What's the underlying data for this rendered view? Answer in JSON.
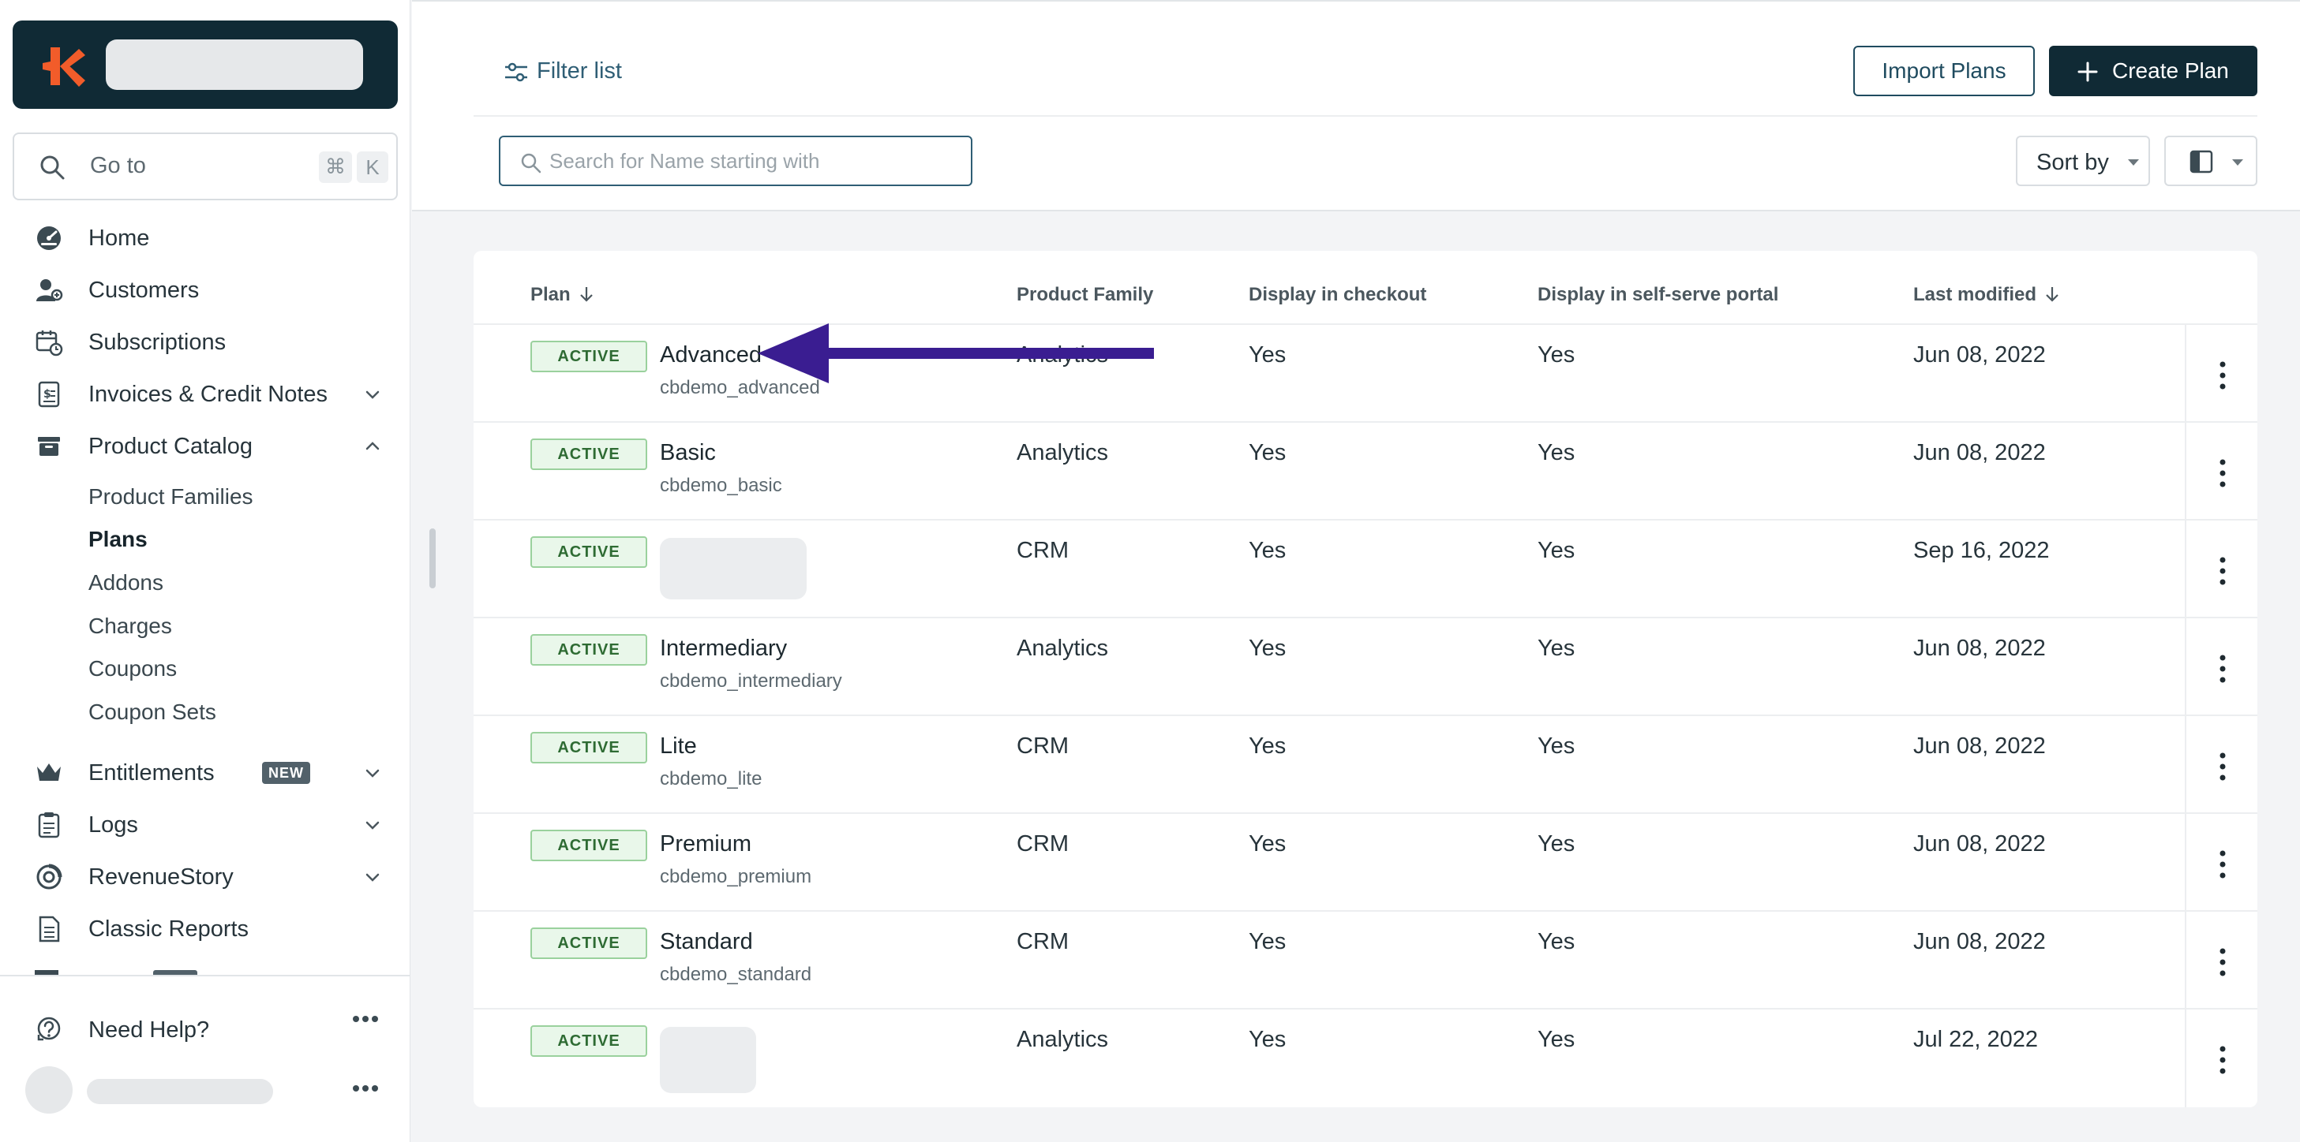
{
  "sidebar": {
    "goto": {
      "label": "Go to",
      "shortcut_cmd": "⌘",
      "shortcut_key": "K"
    },
    "nav": [
      {
        "label": "Home",
        "icon": "dashboard-gauge-icon"
      },
      {
        "label": "Customers",
        "icon": "customers-icon"
      },
      {
        "label": "Subscriptions",
        "icon": "subscriptions-calendar-icon"
      },
      {
        "label": "Invoices & Credit Notes",
        "icon": "invoice-icon",
        "expandable": true
      },
      {
        "label": "Product Catalog",
        "icon": "product-catalog-box-icon",
        "expanded": true
      },
      {
        "label": "Entitlements",
        "icon": "crown-icon",
        "badge": "NEW",
        "expandable": true
      },
      {
        "label": "Logs",
        "icon": "clipboard-icon",
        "expandable": true
      },
      {
        "label": "RevenueStory",
        "icon": "revenue-story-icon",
        "expandable": true
      },
      {
        "label": "Classic Reports",
        "icon": "report-icon"
      }
    ],
    "product_catalog_items": [
      "Product Families",
      "Plans",
      "Addons",
      "Charges",
      "Coupons",
      "Coupon Sets"
    ],
    "active_item": "Plans",
    "help_label": "Need Help?"
  },
  "toolbar": {
    "filter_label": "Filter list",
    "import_label": "Import Plans",
    "create_label": "Create Plan",
    "search_placeholder": "Search for Name starting with",
    "sort_label": "Sort by"
  },
  "table": {
    "headers": {
      "plan": "Plan",
      "family": "Product Family",
      "checkout": "Display in checkout",
      "portal": "Display in self-serve portal",
      "modified": "Last modified"
    },
    "rows": [
      {
        "status": "ACTIVE",
        "name": "Advanced",
        "id": "cbdemo_advanced",
        "family": "Analytics",
        "checkout": "Yes",
        "portal": "Yes",
        "modified": "Jun 08, 2022"
      },
      {
        "status": "ACTIVE",
        "name": "Basic",
        "id": "cbdemo_basic",
        "family": "Analytics",
        "checkout": "Yes",
        "portal": "Yes",
        "modified": "Jun 08, 2022"
      },
      {
        "status": "ACTIVE",
        "name": "",
        "id": "",
        "family": "CRM",
        "checkout": "Yes",
        "portal": "Yes",
        "modified": "Sep 16, 2022"
      },
      {
        "status": "ACTIVE",
        "name": "Intermediary",
        "id": "cbdemo_intermediary",
        "family": "Analytics",
        "checkout": "Yes",
        "portal": "Yes",
        "modified": "Jun 08, 2022"
      },
      {
        "status": "ACTIVE",
        "name": "Lite",
        "id": "cbdemo_lite",
        "family": "CRM",
        "checkout": "Yes",
        "portal": "Yes",
        "modified": "Jun 08, 2022"
      },
      {
        "status": "ACTIVE",
        "name": "Premium",
        "id": "cbdemo_premium",
        "family": "CRM",
        "checkout": "Yes",
        "portal": "Yes",
        "modified": "Jun 08, 2022"
      },
      {
        "status": "ACTIVE",
        "name": "Standard",
        "id": "cbdemo_standard",
        "family": "CRM",
        "checkout": "Yes",
        "portal": "Yes",
        "modified": "Jun 08, 2022"
      },
      {
        "status": "ACTIVE",
        "name": "",
        "id": "",
        "family": "Analytics",
        "checkout": "Yes",
        "portal": "Yes",
        "modified": "Jul 22, 2022"
      }
    ]
  },
  "colors": {
    "brand_dark": "#102a35",
    "brand_orange": "#f25c2a",
    "link_teal": "#2f5e75",
    "active_badge_bg": "#e9f7ea",
    "active_badge_border": "#9ad19d",
    "annotation_arrow": "#3a1d91"
  }
}
